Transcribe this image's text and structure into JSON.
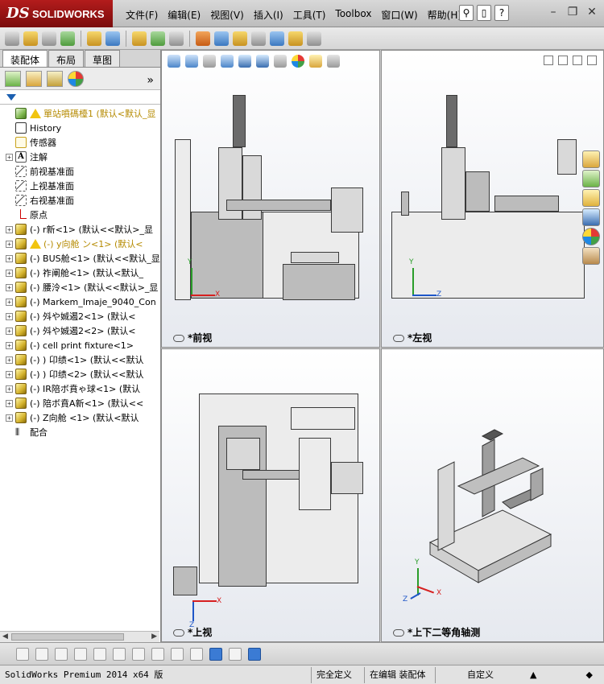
{
  "app": {
    "logo_ds": "DS",
    "logo_name": "SOLIDWORKS"
  },
  "menu": [
    "文件(F)",
    "编辑(E)",
    "视图(V)",
    "插入(I)",
    "工具(T)",
    "Toolbox",
    "窗口(W)",
    "帮助(H)"
  ],
  "tabs": [
    "装配体",
    "布局",
    "草图"
  ],
  "tree": [
    {
      "label": "單站噴碼檯1  (默认<默认_显",
      "kind": "asm",
      "expand": false,
      "warn": true,
      "style": "root"
    },
    {
      "label": "History",
      "kind": "hist",
      "expand": false
    },
    {
      "label": "传感器",
      "kind": "sens",
      "expand": false
    },
    {
      "label": "注解",
      "kind": "note",
      "expand": true
    },
    {
      "label": "前视基准面",
      "kind": "plane",
      "expand": false
    },
    {
      "label": "上视基准面",
      "kind": "plane",
      "expand": false
    },
    {
      "label": "右视基准面",
      "kind": "plane",
      "expand": false
    },
    {
      "label": "原点",
      "kind": "origin",
      "expand": false
    },
    {
      "label": "(-) r新<1> (默认<<默认>_显",
      "kind": "part",
      "expand": true
    },
    {
      "label": "(-) y向舱  ン<1> (默认<",
      "kind": "part",
      "expand": true,
      "warn": true,
      "style": "warnrow"
    },
    {
      "label": "(-) BUS舱<1> (默认<<默认_显",
      "kind": "part",
      "expand": true
    },
    {
      "label": "(-) 祚阐舱<1> (默认<默认_",
      "kind": "part",
      "expand": true
    },
    {
      "label": "(-) 腰泠<1> (默认<<默认>_显",
      "kind": "part",
      "expand": true
    },
    {
      "label": "(-) Markem_Imaje_9040_Con",
      "kind": "part",
      "expand": true
    },
    {
      "label": "(-)   斘や娍遏2<1> (默认<",
      "kind": "part",
      "expand": true
    },
    {
      "label": "(-)   斘や娍遏2<2> (默认<",
      "kind": "part",
      "expand": true
    },
    {
      "label": "(-) cell print fixture<1>",
      "kind": "part",
      "expand": true
    },
    {
      "label": "(-) ) 卬绩<1> (默认<<默认",
      "kind": "part",
      "expand": true
    },
    {
      "label": "(-) ) 卬绩<2> (默认<<默认",
      "kind": "part",
      "expand": true
    },
    {
      "label": "(-) IR陪ボ賁ゃ球<1> (默认",
      "kind": "part",
      "expand": true
    },
    {
      "label": "(-) 陪ボ賁A新<1> (默认<<",
      "kind": "part",
      "expand": true
    },
    {
      "label": "(-) Z向舱  <1> (默认<默认",
      "kind": "part",
      "expand": true
    },
    {
      "label": "配合",
      "kind": "mate",
      "expand": false
    }
  ],
  "viewports": {
    "front": "*前视",
    "left": "*左视",
    "top": "*上视",
    "iso": "*上下二等角轴测"
  },
  "triad": {
    "x": "X",
    "y": "Y",
    "z": "Z"
  },
  "status": {
    "app": "SolidWorks Premium 2014 x64 版",
    "defined": "完全定义",
    "editing": "在编辑 装配体",
    "custom": "自定义"
  }
}
